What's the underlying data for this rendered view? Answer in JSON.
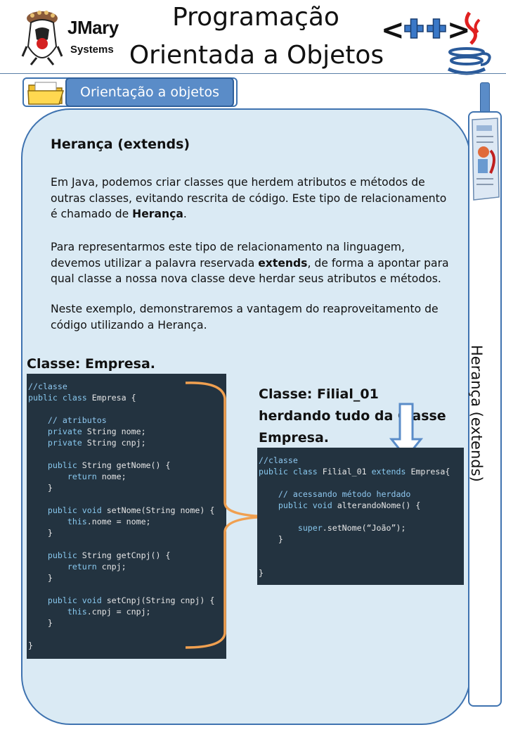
{
  "header": {
    "brand_line1": "JMary",
    "brand_line2": "Systems",
    "title_line1": "Programação",
    "title_line2": "Orientada a Objetos",
    "cpp_logo_icon": "cpp-logo-icon",
    "java_logo_icon": "java-cup-icon"
  },
  "section": {
    "label": "Orientação a objetos",
    "icon": "folder-icon"
  },
  "sidebar": {
    "label": "Herança (extends)",
    "icon": "newspaper-icon"
  },
  "content": {
    "heading": "Herança (extends)",
    "p1_before": "Em Java, podemos criar classes que herdem atributos e métodos de outras classes, evitando rescrita de código. Este tipo de relacionamento é chamado de ",
    "p1_bold": "Herança",
    "p1_after": ".",
    "p2_before": "Para representarmos este tipo de relacionamento na linguagem, devemos utilizar a palavra reservada ",
    "p2_bold": "extends",
    "p2_after": ", de forma a apontar para qual classe a nossa nova classe deve herdar seus atributos e métodos.",
    "p3": "Neste exemplo, demonstraremos a vantagem do reaproveitamento de código utilizando a Herança."
  },
  "empresa": {
    "label": "Classe: Empresa.",
    "code": [
      "//classe",
      "public class Empresa {",
      "",
      "    // atributos",
      "    private String nome;",
      "    private String cnpj;",
      "",
      "    public String getNome() {",
      "        return nome;",
      "    }",
      "",
      "    public void setNome(String nome) {",
      "        this.nome = nome;",
      "    }",
      "",
      "    public String getCnpj() {",
      "        return cnpj;",
      "    }",
      "",
      "    public void setCnpj(String cnpj) {",
      "        this.cnpj = cnpj;",
      "    }",
      "",
      "}"
    ]
  },
  "filial": {
    "label": "Classe: Filial_01 herdando tudo da Classe Empresa.",
    "code": [
      "//classe",
      "public class Filial_01 extends Empresa{",
      "",
      "    // acessando método herdado",
      "    public void alterandoNome() {",
      "",
      "        super.setNome(“João”);",
      "    }",
      "",
      "",
      "}"
    ]
  },
  "colors": {
    "panel_bg": "#daeaf4",
    "border_blue": "#3f73b0",
    "button_blue": "#5a8cc8",
    "code_bg": "#233340",
    "brace_orange": "#f0a050"
  }
}
